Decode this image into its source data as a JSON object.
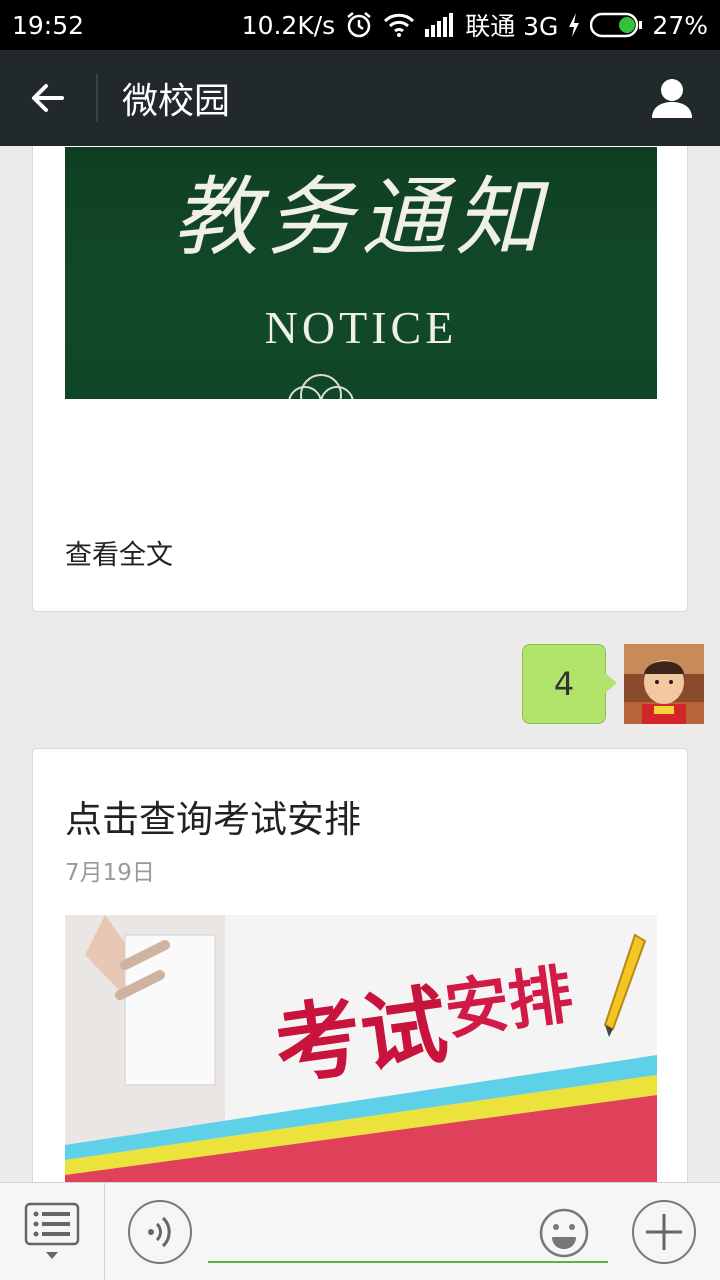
{
  "status_bar": {
    "time": "19:52",
    "speed": "10.2K/s",
    "carrier": "联通 3G",
    "battery": "27%"
  },
  "nav": {
    "title": "微校园"
  },
  "card1": {
    "image_title": "教务通知",
    "image_subtitle": "NOTICE",
    "read_more": "查看全文"
  },
  "message": {
    "text": "4"
  },
  "card2": {
    "title": "点击查询考试安排",
    "date": "7月19日",
    "image_text_1": "考试",
    "image_text_2": "安排"
  },
  "colors": {
    "nav_bg": "#22292c",
    "bubble": "#b2e36a",
    "input_underline": "#5bb33f",
    "notice_bg": "#124a28",
    "exam_red": "#e0415a"
  }
}
